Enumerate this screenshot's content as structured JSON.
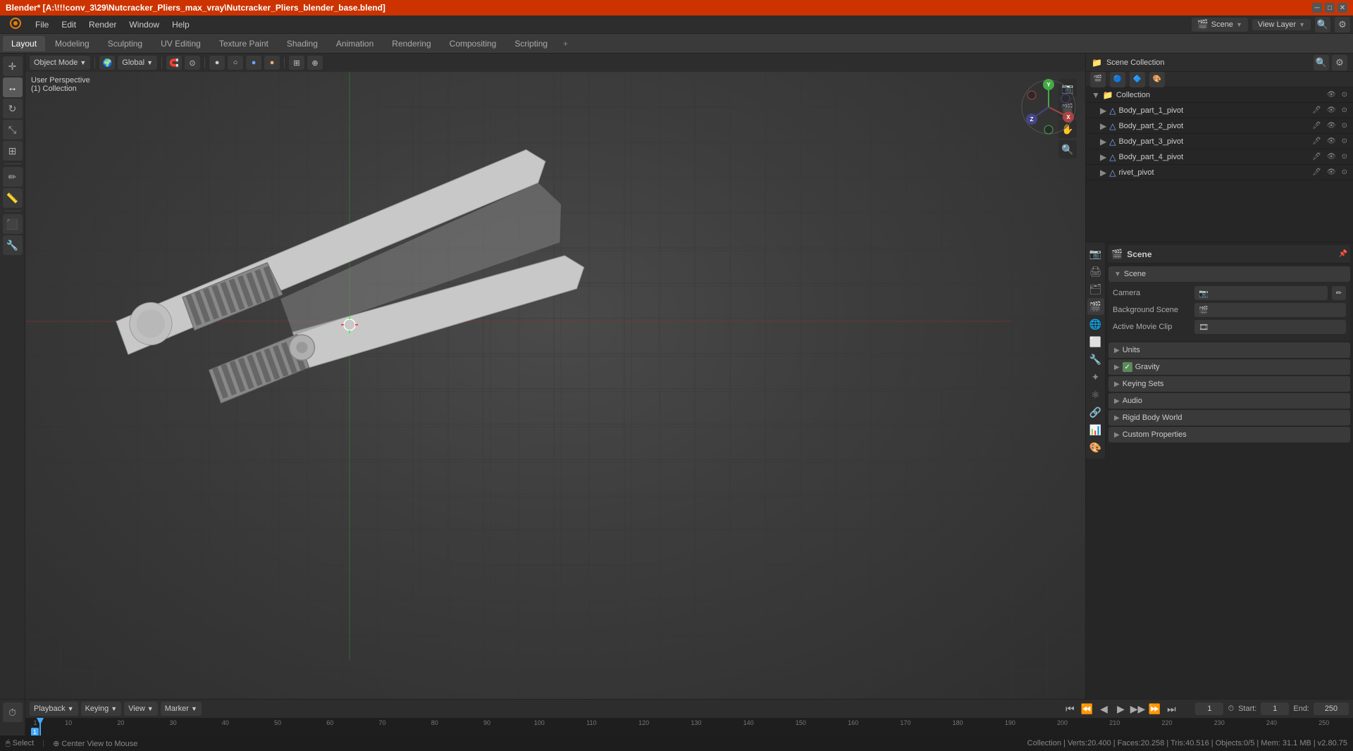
{
  "window": {
    "title": "Blender* [A:\\!!!conv_3\\29\\Nutcracker_Pliers_max_vray\\Nutcracker_Pliers_blender_base.blend]",
    "controls": [
      "─",
      "□",
      "✕"
    ]
  },
  "menu": {
    "items": [
      "Blender",
      "File",
      "Edit",
      "Render",
      "Window",
      "Help"
    ]
  },
  "workspaces": {
    "tabs": [
      "Layout",
      "Modeling",
      "Sculpting",
      "UV Editing",
      "Texture Paint",
      "Shading",
      "Animation",
      "Rendering",
      "Compositing",
      "Scripting",
      "+"
    ]
  },
  "viewport": {
    "mode": "Object Mode",
    "transform": "Global",
    "info_line1": "User Perspective",
    "info_line2": "(1) Collection"
  },
  "outliner": {
    "title": "Scene Collection",
    "items": [
      {
        "label": "Collection",
        "icon": "▼",
        "indent": 0,
        "visible": true
      },
      {
        "label": "Body_part_1_pivot",
        "icon": "△",
        "indent": 1,
        "visible": true
      },
      {
        "label": "Body_part_2_pivot",
        "icon": "△",
        "indent": 1,
        "visible": true
      },
      {
        "label": "Body_part_3_pivot",
        "icon": "△",
        "indent": 1,
        "visible": true
      },
      {
        "label": "Body_part_4_pivot",
        "icon": "△",
        "indent": 1,
        "visible": true
      },
      {
        "label": "rivet_pivot",
        "icon": "△",
        "indent": 1,
        "visible": true
      }
    ]
  },
  "properties": {
    "panel_title": "Scene",
    "scene_name": "Scene",
    "sections": [
      {
        "id": "scene",
        "label": "Scene",
        "expanded": true,
        "rows": [
          {
            "label": "Camera",
            "value": "",
            "icon": "📷"
          },
          {
            "label": "Background Scene",
            "value": "",
            "icon": "🎬"
          },
          {
            "label": "Active Movie Clip",
            "value": "",
            "icon": "🎞"
          }
        ]
      },
      {
        "id": "units",
        "label": "Units",
        "expanded": false,
        "rows": []
      },
      {
        "id": "gravity",
        "label": "Gravity",
        "expanded": false,
        "rows": [],
        "checkbox": true
      },
      {
        "id": "keying_sets",
        "label": "Keying Sets",
        "expanded": false,
        "rows": []
      },
      {
        "id": "audio",
        "label": "Audio",
        "expanded": false,
        "rows": []
      },
      {
        "id": "rigid_body_world",
        "label": "Rigid Body World",
        "expanded": false,
        "rows": []
      },
      {
        "id": "custom_properties",
        "label": "Custom Properties",
        "expanded": false,
        "rows": []
      }
    ]
  },
  "top_right": {
    "scene_label": "Scene",
    "view_layer": "View Layer"
  },
  "timeline": {
    "playback_label": "Playback",
    "keying_label": "Keying",
    "view_label": "View",
    "marker_label": "Marker",
    "frame_current": "1",
    "frame_start": "1",
    "frame_end": "250",
    "numbers": [
      "1",
      "10",
      "20",
      "30",
      "40",
      "50",
      "60",
      "70",
      "80",
      "90",
      "100",
      "110",
      "120",
      "130",
      "140",
      "150",
      "160",
      "170",
      "180",
      "190",
      "200",
      "210",
      "220",
      "230",
      "240",
      "250"
    ]
  },
  "statusbar": {
    "left": "🖱 Select",
    "center": "⊕ Center View to Mouse",
    "right_info": "Collection | Verts:20.400 | Faces:20.258 | Tris:40.516 | Objects:0/5 | Mem: 31.1 MB | v2.80.75"
  }
}
